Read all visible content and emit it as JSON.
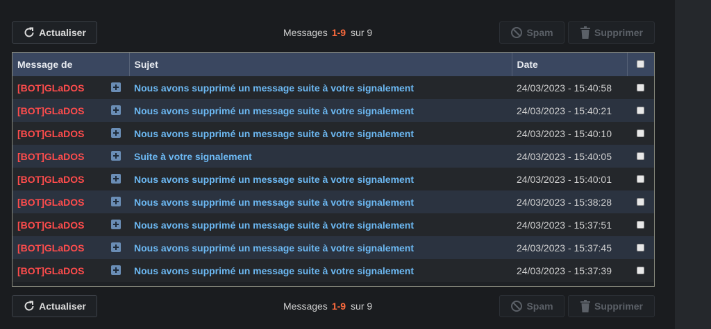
{
  "toolbar": {
    "refresh_label": "Actualiser",
    "spam_label": "Spam",
    "delete_label": "Supprimer",
    "messages_label": "Messages",
    "range": "1-9",
    "total_label": "sur 9"
  },
  "table": {
    "headers": {
      "from": "Message de",
      "subject": "Sujet",
      "date": "Date"
    },
    "rows": [
      {
        "from": "[BOT]GLaDOS",
        "subject": "Nous avons supprimé un message suite à votre signalement",
        "date": "24/03/2023 - 15:40:58"
      },
      {
        "from": "[BOT]GLaDOS",
        "subject": "Nous avons supprimé un message suite à votre signalement",
        "date": "24/03/2023 - 15:40:21"
      },
      {
        "from": "[BOT]GLaDOS",
        "subject": "Nous avons supprimé un message suite à votre signalement",
        "date": "24/03/2023 - 15:40:10"
      },
      {
        "from": "[BOT]GLaDOS",
        "subject": "Suite à votre signalement",
        "date": "24/03/2023 - 15:40:05"
      },
      {
        "from": "[BOT]GLaDOS",
        "subject": "Nous avons supprimé un message suite à votre signalement",
        "date": "24/03/2023 - 15:40:01"
      },
      {
        "from": "[BOT]GLaDOS",
        "subject": "Nous avons supprimé un message suite à votre signalement",
        "date": "24/03/2023 - 15:38:28"
      },
      {
        "from": "[BOT]GLaDOS",
        "subject": "Nous avons supprimé un message suite à votre signalement",
        "date": "24/03/2023 - 15:37:51"
      },
      {
        "from": "[BOT]GLaDOS",
        "subject": "Nous avons supprimé un message suite à votre signalement",
        "date": "24/03/2023 - 15:37:45"
      },
      {
        "from": "[BOT]GLaDOS",
        "subject": "Nous avons supprimé un message suite à votre signalement",
        "date": "24/03/2023 - 15:37:39"
      }
    ]
  },
  "colors": {
    "background": "#1a1c1f",
    "header_bg": "#3a4760",
    "sender": "#ff4c4c",
    "subject_link": "#6cb8f2",
    "range_accent": "#ff6b3d"
  },
  "icons": {
    "refresh": "refresh-icon",
    "spam": "ban-icon",
    "delete": "trash-icon",
    "expand": "plus-square-icon"
  }
}
